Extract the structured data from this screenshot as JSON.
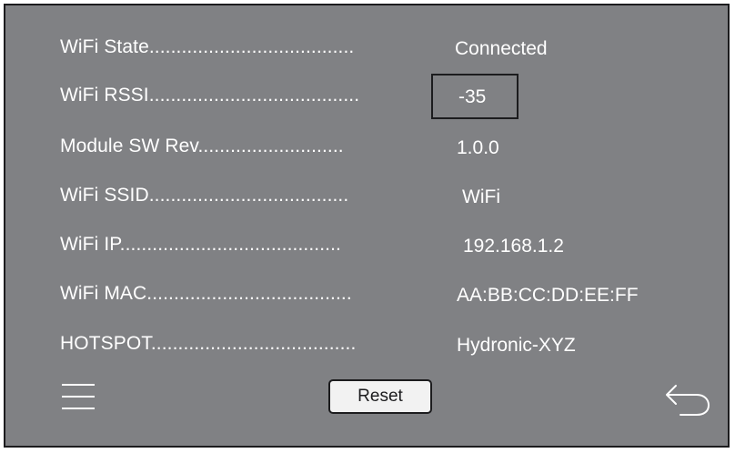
{
  "rows": [
    {
      "label": "WiFi State......................................",
      "value": "Connected"
    },
    {
      "label": "WiFi RSSI.......................................",
      "value": "-35"
    },
    {
      "label": "Module SW Rev...........................",
      "value": "1.0.0"
    },
    {
      "label": "WiFi SSID.....................................",
      "value": "WiFi"
    },
    {
      "label": "WiFi IP.........................................",
      "value": "192.168.1.2"
    },
    {
      "label": "WiFi MAC......................................",
      "value": "AA:BB:CC:DD:EE:FF"
    },
    {
      "label": "HOTSPOT......................................",
      "value": "Hydronic-XYZ"
    }
  ],
  "footer": {
    "menu_icon": "hamburger-menu-icon",
    "reset_label": "Reset",
    "back_icon": "back-arrow-icon"
  },
  "colors": {
    "screen_background": "#808184",
    "text": "#ffffff",
    "border": "#1c1c1e",
    "button_background": "#f2f2f2"
  }
}
